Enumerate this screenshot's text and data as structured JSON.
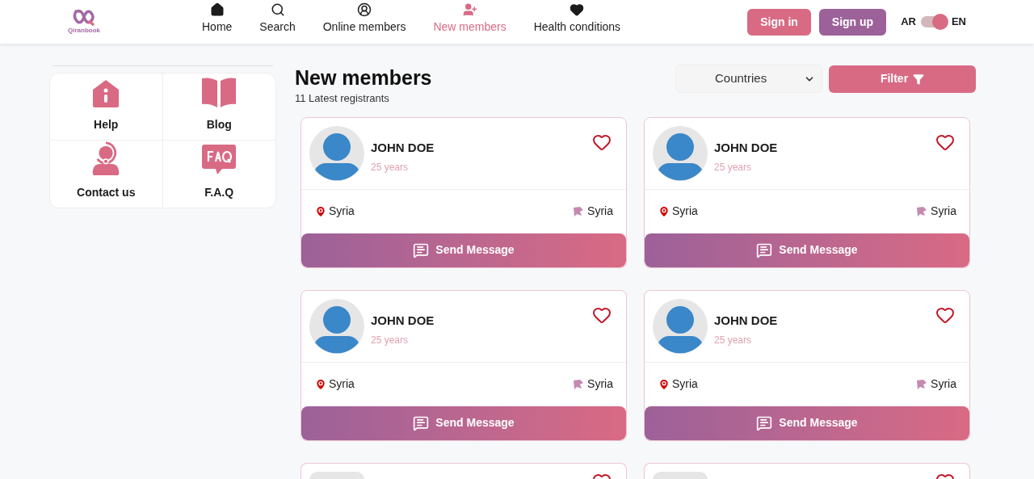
{
  "logo": {
    "text": "Qiranbook"
  },
  "nav": [
    {
      "label": "Home",
      "kind": "home",
      "selected": false
    },
    {
      "label": "Search",
      "kind": "search",
      "selected": false
    },
    {
      "label": "Online members",
      "kind": "online",
      "selected": false
    },
    {
      "label": "New members",
      "kind": "new",
      "selected": true
    },
    {
      "label": "Health conditions",
      "kind": "health",
      "selected": false
    }
  ],
  "auth": {
    "sign_in": "Sign in",
    "sign_up": "Sign up"
  },
  "language": {
    "left": "AR",
    "right": "EN",
    "on": true
  },
  "sidebar": {
    "items": [
      {
        "label": "Help",
        "kind": "help"
      },
      {
        "label": "Blog",
        "kind": "blog"
      },
      {
        "label": "Contact us",
        "kind": "contact"
      },
      {
        "label": "F.A.Q",
        "kind": "faq"
      }
    ]
  },
  "page": {
    "title": "New members",
    "subtitle": "11 Latest registrants"
  },
  "filter": {
    "select": "Countries",
    "button": "Filter"
  },
  "members": [
    {
      "name": "JOHN DOE",
      "age": "25 years",
      "location": "Syria",
      "nationality": "Syria",
      "liked": false,
      "action": "Send Message"
    },
    {
      "name": "JOHN DOE",
      "age": "25 years",
      "location": "Syria",
      "nationality": "Syria",
      "liked": false,
      "action": "Send Message"
    },
    {
      "name": "JOHN DOE",
      "age": "25 years",
      "location": "Syria",
      "nationality": "Syria",
      "liked": false,
      "action": "Send Message"
    },
    {
      "name": "JOHN DOE",
      "age": "25 years",
      "location": "Syria",
      "nationality": "Syria",
      "liked": false,
      "action": "Send Message"
    }
  ],
  "partial_cards": [
    {
      "liked": false
    },
    {
      "liked": false
    }
  ]
}
